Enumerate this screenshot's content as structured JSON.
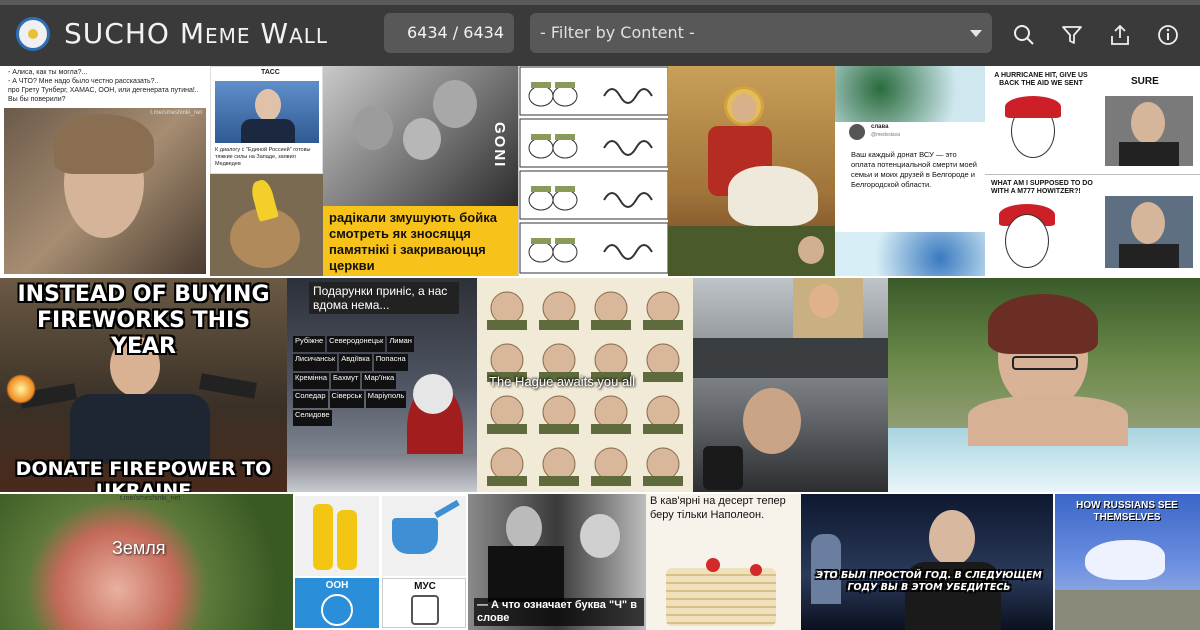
{
  "app": {
    "title": "SUCHO Meme Wall",
    "counter": "6434 / 6434",
    "filter_placeholder": "- Filter by Content -"
  },
  "toolbar": {
    "icons": [
      "search-icon",
      "filter-icon",
      "share-icon",
      "info-icon"
    ]
  },
  "colors": {
    "topbar": "#3a3a3a",
    "control": "#585858",
    "text": "#f2f2f2"
  },
  "memes": {
    "alisa": {
      "text": "- Алиса, как ты могла?...\n- А ЧТО? Мне надо было честно рассказать?..\nпро Грету Тунберг, ХАМАС, ООН, или дегенерата путина!..\nВы бы поверили?",
      "watermark": "t.me/smeshinki_net"
    },
    "tass": {
      "header": "ТАСС",
      "subtext": "К диалогу с \"Единой Россией\" готовы тяжкие силы на Западе, заявил Медведев"
    },
    "goni": {
      "text": "радікали змушують бойка смотреть як зносяцця памятнікі і закриваюцця церкви",
      "logo": "GONI"
    },
    "slava": {
      "name": "слава",
      "handle": "@medvslava",
      "text": "Ваш каждый донат ВСУ — это оплата потенциальной смерти моей семьи и моих друзей в Белгороде и Белгородской области."
    },
    "hurricane": {
      "top_left": "A HURRICANE HIT, GIVE US BACK THE AID WE SENT",
      "top_right": "SURE",
      "bottom": "WHAT AM I SUPPOSED TO DO WITH A M777 HOWITZER?!"
    },
    "fireworks": {
      "top": "INSTEAD OF BUYING FIREWORKS THIS YEAR",
      "bottom": "DONATE FIREPOWER TO UKRAINE"
    },
    "gifts": {
      "top": "Подарунки приніс, а нас вдома нема...",
      "towns": [
        "Рубіжне",
        "Северодонецьк",
        "Лиман",
        "Лисичанськ",
        "Авдіївка",
        "Попасна",
        "Кремінна",
        "Бахмут",
        "Мар'їнка",
        "Соледар",
        "Сіверськ",
        "Маріуполь",
        "Селидове"
      ]
    },
    "hague": {
      "text": "The Hague awaits you all"
    },
    "zemlya": {
      "text": "Земля",
      "watermark": "t.me/smeshinki_net"
    },
    "un": {
      "left": "ООН",
      "right": "МУС"
    },
    "stirlitz": {
      "text": "— А что означает буква \"Ч\" в слове"
    },
    "napoleon": {
      "text": "В кав'ярні на десерт тепер беру тільки Наполеон."
    },
    "putin": {
      "text": "ЭТО БЫЛ ПРОСТОЙ ГОД. В СЛЕДУЮЩЕМ ГОДУ ВЫ В ЭТОМ УБЕДИТЕСЬ"
    },
    "russians": {
      "text": "HOW RUSSIANS SEE THEMSELVES"
    }
  }
}
